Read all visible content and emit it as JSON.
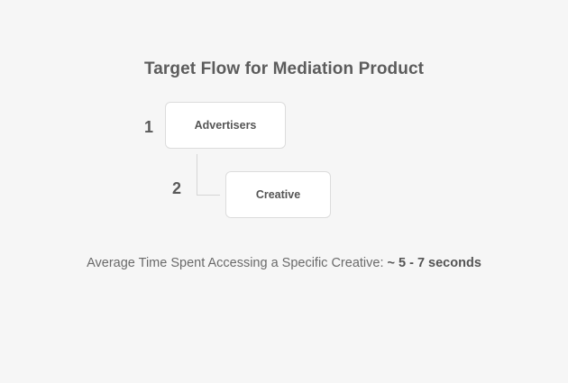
{
  "diagram": {
    "title": "Target Flow for Mediation Product",
    "steps": [
      {
        "number": "1",
        "label": "Advertisers"
      },
      {
        "number": "2",
        "label": "Creative"
      }
    ]
  },
  "footnote": {
    "label": "Average Time Spent Accessing a Specific Creative:",
    "value": "~ 5 - 7 seconds"
  },
  "colors": {
    "background": "#f6f6f6",
    "node_fill": "#ffffff",
    "node_border": "#dcdcdc",
    "connector": "#d6d6d6",
    "text": "#5a5a5a"
  }
}
